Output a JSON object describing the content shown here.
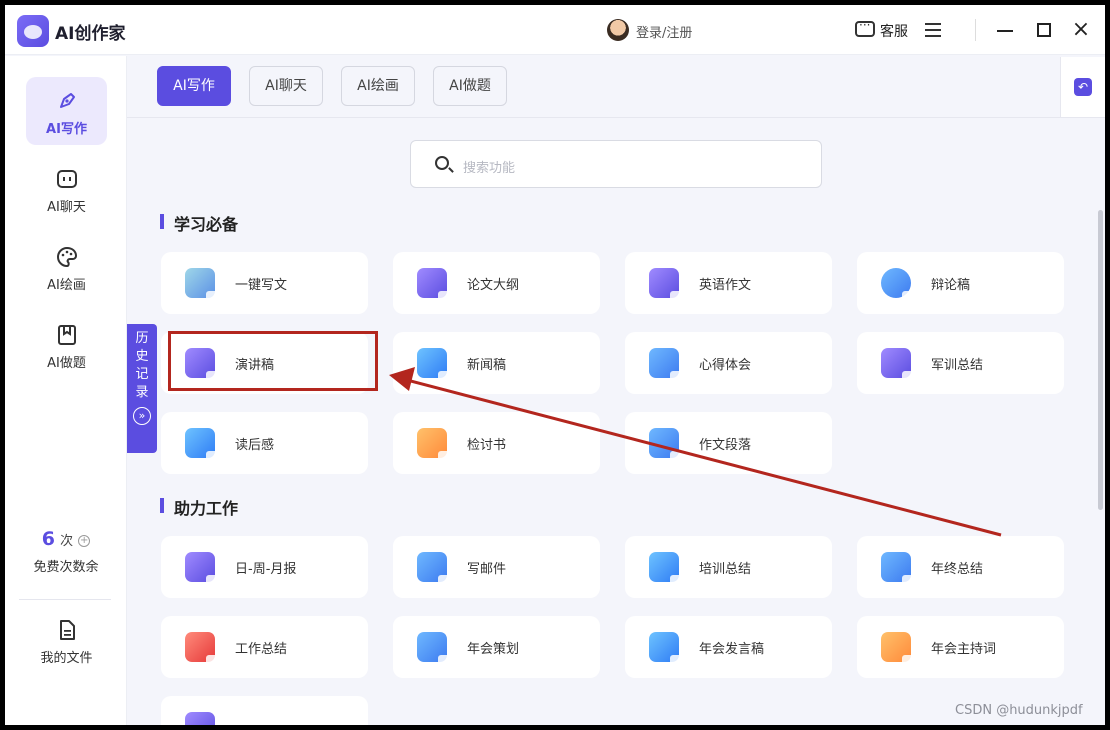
{
  "titlebar": {
    "app_title": "AI创作家",
    "login": "登录/注册",
    "service": "客服"
  },
  "sidebar": {
    "items": [
      {
        "label": "AI写作",
        "icon": "pen-icon",
        "active": true
      },
      {
        "label": "AI聊天",
        "icon": "chat-bot-icon",
        "active": false
      },
      {
        "label": "AI绘画",
        "icon": "palette-icon",
        "active": false
      },
      {
        "label": "AI做题",
        "icon": "bookmark-icon",
        "active": false
      }
    ],
    "quota": {
      "count": "6",
      "unit": "次",
      "label": "免费次数余"
    },
    "my_files": "我的文件"
  },
  "history_tab": [
    "历",
    "史",
    "记",
    "录"
  ],
  "tabs": [
    "AI写作",
    "AI聊天",
    "AI绘画",
    "AI做题"
  ],
  "search": {
    "placeholder": "搜索功能"
  },
  "sections": [
    {
      "title": "学习必备",
      "cards": [
        {
          "label": "一键写文",
          "color": "teal"
        },
        {
          "label": "论文大纲",
          "color": "purple"
        },
        {
          "label": "英语作文",
          "color": "purple"
        },
        {
          "label": "辩论稿",
          "color": "sky"
        },
        {
          "label": "演讲稿",
          "color": "purple"
        },
        {
          "label": "新闻稿",
          "color": "blue"
        },
        {
          "label": "心得体会",
          "color": "sky"
        },
        {
          "label": "军训总结",
          "color": "purple"
        },
        {
          "label": "读后感",
          "color": "blue"
        },
        {
          "label": "检讨书",
          "color": "orange"
        },
        {
          "label": "作文段落",
          "color": "sky"
        }
      ]
    },
    {
      "title": "助力工作",
      "cards": [
        {
          "label": "日-周-月报",
          "color": "purple"
        },
        {
          "label": "写邮件",
          "color": "sky"
        },
        {
          "label": "培训总结",
          "color": "blue"
        },
        {
          "label": "年终总结",
          "color": "sky"
        },
        {
          "label": "工作总结",
          "color": "red"
        },
        {
          "label": "年会策划",
          "color": "sky"
        },
        {
          "label": "年会发言稿",
          "color": "blue"
        },
        {
          "label": "年会主持词",
          "color": "orange"
        }
      ]
    }
  ],
  "watermark": "CSDN @hudunkjpdf"
}
